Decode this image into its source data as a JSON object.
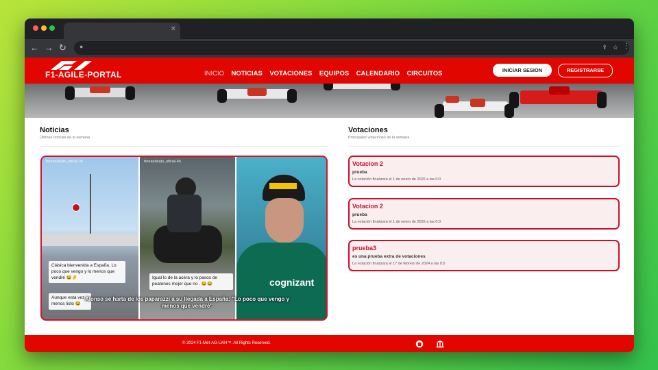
{
  "brand": {
    "name": "F1-AGILE-PORTAL",
    "primary_color": "#e10600",
    "card_border_color": "#c8102e"
  },
  "nav": [
    {
      "label": "INICIO",
      "active": true
    },
    {
      "label": "NOTICIAS",
      "active": false
    },
    {
      "label": "VOTACIONES",
      "active": false
    },
    {
      "label": "EQUIPOS",
      "active": false
    },
    {
      "label": "CALENDARIO",
      "active": false
    },
    {
      "label": "CIRCUITOS",
      "active": false
    }
  ],
  "auth": {
    "login_label": "INICIAR SESION",
    "register_label": "REGISTRARSE"
  },
  "news": {
    "title": "Noticias",
    "subtitle": "Últimas noticias de la semana",
    "story_user_1": "fernandoalo_oficial",
    "story_time_1": "3h",
    "story_user_2": "fernandoalo_oficial",
    "story_time_2": "4h",
    "sticker_1": "Clásica bienvenida a España. Lo poco que vengo y lo menos que vendré 😂🤌",
    "sticker_2": "Aunque esta vez menos listo 😂",
    "sticker_3": "Igual lo de la acera y lo pasos de peatones mejor que no . 😂😂",
    "headline": "Alonso se harta de los paparazzi a su llegada a España: \"Lo poco que vengo y menos que vendré\""
  },
  "votes": {
    "title": "Votaciones",
    "subtitle": "Principales votaciones de la semana",
    "items": [
      {
        "title": "Votacion 2",
        "description": "prueba",
        "ends": "La votación finalizará el 1 de enero de 2026 a las 0:0"
      },
      {
        "title": "Votacion 2",
        "description": "prueba",
        "ends": "La votación finalizará el 1 de enero de 2026 a las 0:0"
      },
      {
        "title": "prueba3",
        "description": "es una prueba extra de votaciones",
        "ends": "La votación finalizará el 17 de febrero de 2024 a las 0:0"
      }
    ]
  },
  "footer": {
    "copyright": "© 2024 F1-Met-AG-UAH™. All Rights Reserved.",
    "icons": [
      "github-icon",
      "university-icon"
    ]
  }
}
